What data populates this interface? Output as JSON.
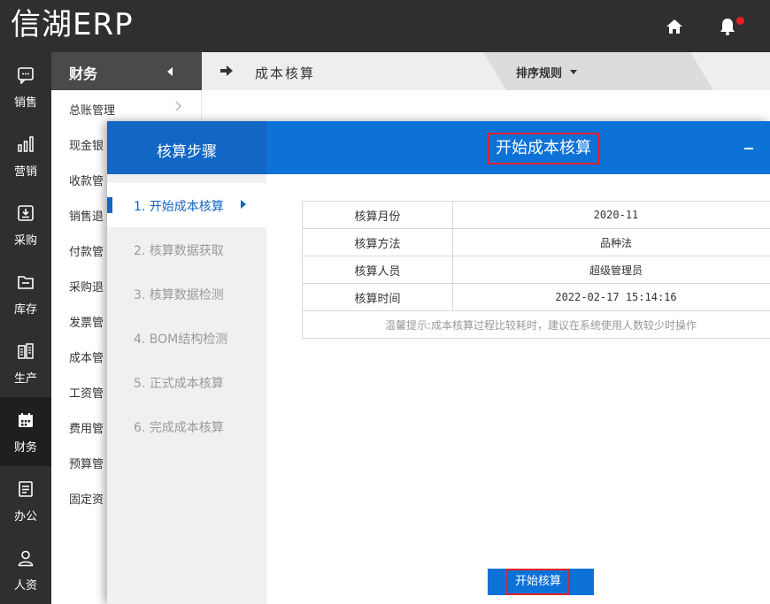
{
  "app": {
    "logo": "信湖ERP"
  },
  "topbar": {
    "home_icon": "home-icon",
    "bell_icon": "bell-icon"
  },
  "leftnav": {
    "items": [
      {
        "label": "销售",
        "icon": "chat-icon"
      },
      {
        "label": "营销",
        "icon": "bar-chart-icon"
      },
      {
        "label": "采购",
        "icon": "download-box-icon"
      },
      {
        "label": "库存",
        "icon": "folder-icon"
      },
      {
        "label": "生产",
        "icon": "building-icon"
      },
      {
        "label": "财务",
        "icon": "calendar-icon",
        "active": true
      },
      {
        "label": "办公",
        "icon": "document-icon"
      },
      {
        "label": "人资",
        "icon": "user-icon"
      }
    ]
  },
  "submenu": {
    "title": "财务",
    "items": [
      "总账管理",
      "现金银",
      "收款管",
      "销售退",
      "付款管",
      "采购退",
      "发票管",
      "成本管",
      "工资管",
      "费用管",
      "预算管",
      "固定资"
    ]
  },
  "breadcrumb": {
    "title": "成本核算",
    "sort_label": "排序规则"
  },
  "modal": {
    "steps_title": "核算步骤",
    "title": "开始成本核算",
    "steps": [
      "1. 开始成本核算",
      "2. 核算数据获取",
      "3. 核算数据检测",
      "4. BOM结构检测",
      "5. 正式成本核算",
      "6. 完成成本核算"
    ],
    "info": [
      {
        "key": "核算月份",
        "value": "2020-11"
      },
      {
        "key": "核算方法",
        "value": "品种法"
      },
      {
        "key": "核算人员",
        "value": "超级管理员"
      },
      {
        "key": "核算时间",
        "value": "2022-02-17 15:14:16"
      }
    ],
    "tip": "温馨提示:成本核算过程比较耗时，建议在系统使用人数较少时操作",
    "start_button": "开始核算"
  }
}
